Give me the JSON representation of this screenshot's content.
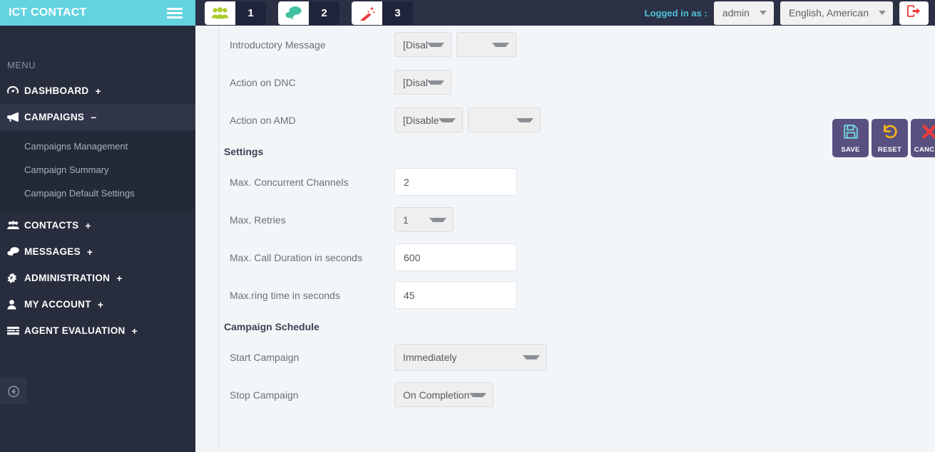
{
  "sidebar": {
    "brand": "ICT CONTACT",
    "hamburger_icon": "hamburger-icon",
    "menu_label": "MENU",
    "items": [
      {
        "label": "DASHBOARD",
        "sign": "+",
        "icon": "dashboard-icon",
        "active": false
      },
      {
        "label": "CAMPAIGNS",
        "sign": "−",
        "icon": "megaphone-icon",
        "active": true
      },
      {
        "label": "CONTACTS",
        "sign": "+",
        "icon": "contacts-icon",
        "active": false
      },
      {
        "label": "MESSAGES",
        "sign": "+",
        "icon": "messages-icon",
        "active": false
      },
      {
        "label": "ADMINISTRATION",
        "sign": "+",
        "icon": "gears-icon",
        "active": false
      },
      {
        "label": "MY ACCOUNT",
        "sign": "+",
        "icon": "user-icon",
        "active": false
      },
      {
        "label": "AGENT EVALUATION",
        "sign": "+",
        "icon": "list-icon",
        "active": false
      }
    ],
    "submenu": [
      "Campaigns Management",
      "Campaign Summary",
      "Campaign Default Settings"
    ],
    "collapse_icon": "circle-arrow-left-icon"
  },
  "topbar": {
    "steps": [
      {
        "number": "1",
        "icon": "users-group-icon",
        "color": "#aacc29"
      },
      {
        "number": "2",
        "icon": "chat-bubbles-icon",
        "color": "#3fc1a0"
      },
      {
        "number": "3",
        "icon": "magic-wand-icon",
        "color": "#ef3b3b"
      }
    ],
    "logged_in_label": "Logged in as :",
    "user": "admin",
    "language": "English, American",
    "logout_icon": "logout-icon",
    "accent": "#4fc3d9"
  },
  "form": {
    "rows": [
      {
        "label": "Introductory Message",
        "control": "select-pair",
        "value": "[Disabl...",
        "value2": ""
      },
      {
        "label": "Action on DNC",
        "control": "select",
        "value": "[Disabl..."
      },
      {
        "label": "Action on AMD",
        "control": "select-pair-lg",
        "value": "[Disabled]",
        "value2": ""
      }
    ],
    "settings_heading": "Settings",
    "settings": [
      {
        "label": "Max. Concurrent Channels",
        "control": "text",
        "value": "2"
      },
      {
        "label": "Max. Retries",
        "control": "select",
        "value": "1"
      },
      {
        "label": "Max. Call Duration in seconds",
        "control": "text",
        "value": "600"
      },
      {
        "label": "Max.ring time in seconds",
        "control": "text",
        "value": "45"
      }
    ],
    "schedule_heading": "Campaign Schedule",
    "schedule": [
      {
        "label": "Start Campaign",
        "control": "select",
        "value": "Immediately"
      },
      {
        "label": "Stop Campaign",
        "control": "select",
        "value": "On Completion"
      }
    ]
  },
  "actions": [
    {
      "label": "SAVE",
      "icon": "floppy-disk-icon",
      "color": "#6fd5d8"
    },
    {
      "label": "RESET",
      "icon": "undo-arrow-icon",
      "color": "#f5b717"
    },
    {
      "label": "CANCEL",
      "icon": "cross-icon",
      "color": "#ef3b3b"
    }
  ],
  "colors": {
    "brand_teal": "#63d3e0",
    "sidebar_dark": "#282d3d",
    "topbar_dark": "#2b3045",
    "button_purple": "#5a5080",
    "page_bg": "#f0f4f7"
  }
}
